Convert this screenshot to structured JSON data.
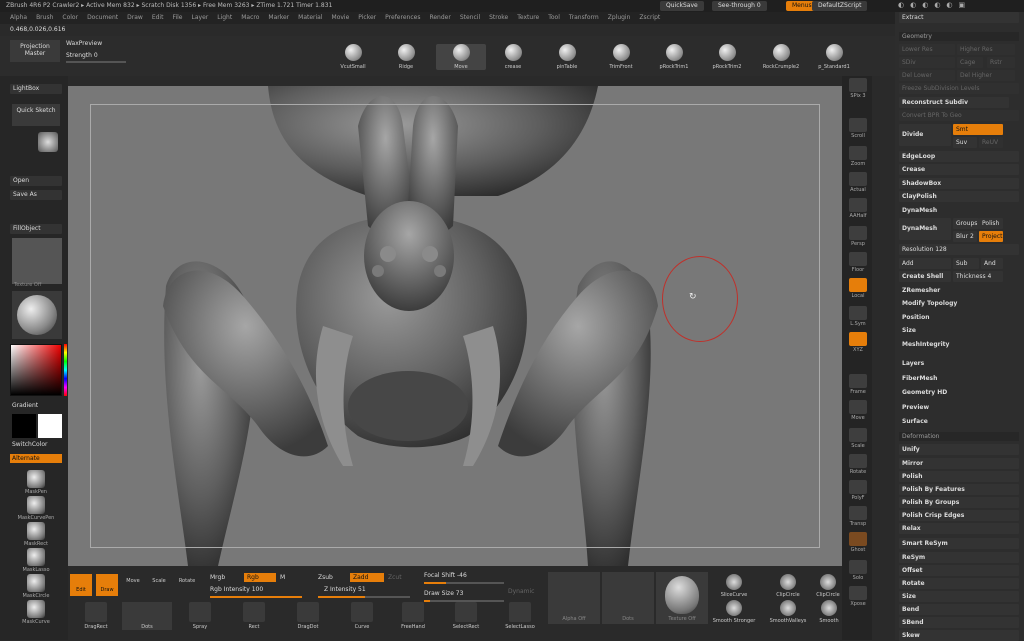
{
  "title_bar": "ZBrush 4R6 P2   Crawler2  ▸ Active Mem 832 ▸ Scratch Disk 1356 ▸ Free Mem 3263 ▸ ZTime 1.721 Timer 1.831",
  "menu": [
    "Alpha",
    "Brush",
    "Color",
    "Document",
    "Draw",
    "Edit",
    "File",
    "Layer",
    "Light",
    "Macro",
    "Marker",
    "Material",
    "Movie",
    "Picker",
    "Preferences",
    "Render",
    "Stencil",
    "Stroke",
    "Texture",
    "Tool",
    "Transform",
    "Zplugin",
    "Zscript"
  ],
  "top_right": {
    "quicksave": "QuickSave",
    "seethrough": "See-through   0",
    "menus": "Menus",
    "script": "DefaultZScript"
  },
  "coords": "0.468,0.026,0.616",
  "projection": {
    "label": "Projection Master",
    "wax": "WaxPreview",
    "strength": "Strength 0",
    "strength_value": 0
  },
  "brushes": [
    "VcutSmall",
    "Ridge",
    "Move",
    "crease",
    "pinTable",
    "TrimFront",
    "pRockTrim1",
    "pRockTrim2",
    "RockCrumple2",
    "p_Standard1"
  ],
  "left": {
    "lightbox": "LightBox",
    "quicksketch": "Quick Sketch",
    "open": "Open",
    "saveas": "Save As",
    "fillobject": "FillObject",
    "texture_off": "Texture Off",
    "gradient": "Gradient",
    "switchcolor": "SwitchColor",
    "alternate": "Alternate",
    "tools": [
      "MaskPen",
      "MaskCurvePen",
      "MaskRect",
      "MaskLasso",
      "MaskCircle",
      "MaskCurve"
    ]
  },
  "right_strip": [
    "SPix 3",
    "Scroll",
    "Zoom",
    "Actual",
    "AAHalf",
    "Persp",
    "Floor",
    "Local",
    "L.Sym",
    "XYZ",
    "Frame",
    "Move",
    "Scale",
    "Rotate",
    "PolyF",
    "Transp",
    "Ghost",
    "Solo",
    "Xpose"
  ],
  "geometry": {
    "extract": "Extract",
    "header": "Geometry",
    "lower": "Lower Res",
    "higher": "Higher Res",
    "sdiv": "SDiv",
    "cage": "Cage",
    "rstr": "Rstr",
    "del_lower": "Del Lower",
    "del_higher": "Del Higher",
    "freeze": "Freeze SubDivision Levels",
    "reconstruct": "Reconstruct Subdiv",
    "convert": "Convert BPR To Geo",
    "divide": "Divide",
    "smt": "Smt",
    "suv": "Suv",
    "reuv": "ReUV",
    "edgeloop": "EdgeLoop",
    "crease": "Crease",
    "shadowbox": "ShadowBox",
    "claypolish": "ClayPolish",
    "dynamesh_hdr": "DynaMesh",
    "dynamesh": "DynaMesh",
    "groups": "Groups",
    "polish": "Polish",
    "blur": "Blur 2",
    "project": "Project",
    "resolution": "Resolution 128",
    "add": "Add",
    "sub": "Sub",
    "and": "And",
    "createshell": "Create Shell",
    "thickness": "Thickness 4",
    "zremesher": "ZRemesher",
    "modify": "Modify Topology",
    "position": "Position",
    "size": "Size",
    "meshint": "MeshIntegrity"
  },
  "subpalettes": [
    "Layers",
    "FiberMesh",
    "Geometry HD",
    "Preview",
    "Surface"
  ],
  "deformation": {
    "header": "Deformation",
    "items": [
      "Unify",
      "Mirror",
      "Polish",
      "Polish By Features",
      "Polish By Groups",
      "Polish Crisp Edges",
      "Relax",
      "Smart ReSym",
      "ReSym",
      "Offset",
      "Rotate",
      "Size",
      "Bend",
      "SBend",
      "Skew"
    ]
  },
  "bottom": {
    "edit": "Edit",
    "draw": "Draw",
    "move": "Move",
    "scale": "Scale",
    "rotate": "Rotate",
    "mrgb": "Mrgb",
    "rgb": "Rgb",
    "m": "M",
    "rgb_intensity": "Rgb Intensity 100",
    "rgb_intensity_value": 100,
    "zsub": "Zsub",
    "zadd": "Zadd",
    "zcut": "Zcut",
    "z_intensity": "Z Intensity 51",
    "z_intensity_value": 51,
    "focal": "Focal Shift -46",
    "focal_value": -46,
    "drawsize": "Draw Size 73",
    "drawsize_value": 73,
    "dynamic": "Dynamic",
    "dragrect": "DragRect",
    "dots": "Dots",
    "spray": "Spray",
    "rect": "Rect",
    "dragdot": "DragDot",
    "curve": "Curve",
    "freehand": "FreeHand",
    "selectrect": "SelectRect",
    "selectlasso": "SelectLasso",
    "alpha_off": "Alpha Off",
    "dots2": "Dots",
    "texture_off": "Texture Off",
    "slicecurve": "SliceCurve",
    "clipcircle": "ClipCircle",
    "clipcircle2": "ClipCircle",
    "smooth_stronger": "Smooth Stronger",
    "smooth_valleys": "SmoothValleys",
    "smooth": "Smooth"
  },
  "colors": {
    "accent": "#e67e0a",
    "canvas": "#787878",
    "panel": "#2d2d2d"
  }
}
